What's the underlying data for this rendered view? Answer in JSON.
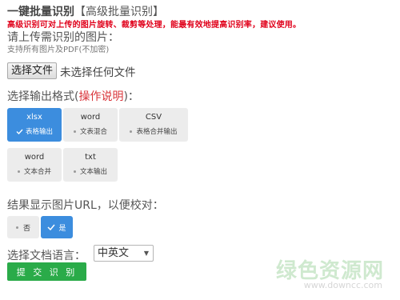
{
  "title": {
    "main": "一键批量识别",
    "sub": "【高级批量识别】"
  },
  "warning": "高级识别可对上传的图片旋转、裁剪等处理，能最有效地提高识别率，建议使用。",
  "upload": {
    "label": "请上传需识别的图片：",
    "support": "支持所有图片及PDF(不加密)",
    "button": "选择文件",
    "status": "未选择任何文件"
  },
  "format": {
    "label_prefix": "选择输出格式(",
    "help_link": "操作说明",
    "label_suffix": ")：",
    "options": [
      {
        "title": "xlsx",
        "sub": "表格输出",
        "selected": true
      },
      {
        "title": "word",
        "sub": "文表混合",
        "selected": false
      },
      {
        "title": "CSV",
        "sub": "表格合并输出",
        "selected": false
      },
      {
        "title": "word",
        "sub": "文本合并",
        "selected": false
      },
      {
        "title": "txt",
        "sub": "文本输出",
        "selected": false
      }
    ]
  },
  "url_option": {
    "label": "结果显示图片URL，以便校对：",
    "no": "否",
    "yes": "是",
    "selected": "yes"
  },
  "language": {
    "label": "选择文档语言：",
    "value": "中英文"
  },
  "submit": "提 交 识 别",
  "watermark": {
    "logo": "绿色资源网",
    "url": "www.downcc.com"
  },
  "colors": {
    "accent": "#3c8dde",
    "submit": "#2aab49",
    "warning": "#e0001a",
    "help": "#d9343a"
  }
}
